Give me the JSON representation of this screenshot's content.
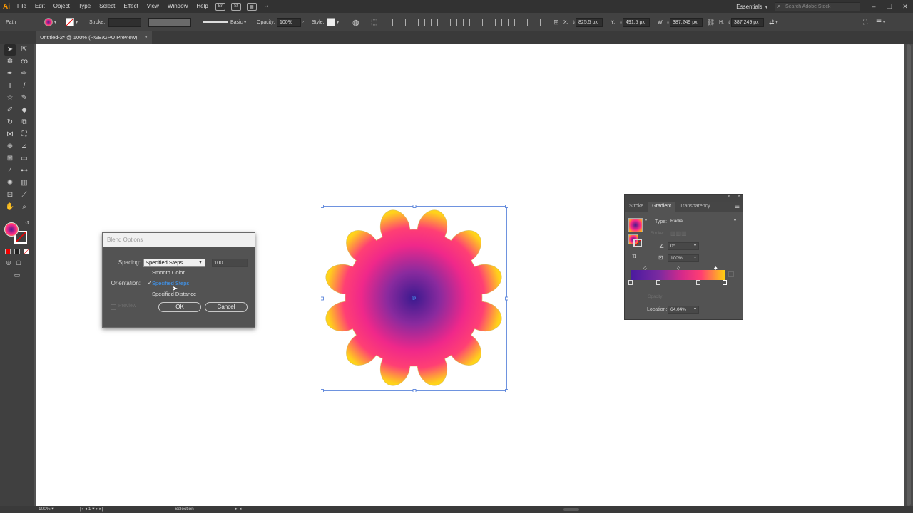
{
  "app": {
    "logo": "Ai"
  },
  "menu": [
    "File",
    "Edit",
    "Object",
    "Type",
    "Select",
    "Effect",
    "View",
    "Window",
    "Help"
  ],
  "menu_icons": [
    "Br",
    "St"
  ],
  "workspace": {
    "label": "Essentials"
  },
  "stock_search": {
    "placeholder": "Search Adobe Stock"
  },
  "control_bar": {
    "selection_type": "Path",
    "stroke_label": "Stroke:",
    "stroke_style": "Basic",
    "opacity_label": "Opacity:",
    "opacity_value": "100%",
    "style_label": "Style:",
    "x_label": "X:",
    "x_value": "825.5 px",
    "y_label": "Y:",
    "y_value": "491.5 px",
    "w_label": "W:",
    "w_value": "387.249 px",
    "h_label": "H:",
    "h_value": "387.249 px"
  },
  "document_tab": {
    "title": "Untitled-2* @ 100% (RGB/GPU Preview)",
    "close": "×"
  },
  "status_bar": {
    "zoom": "100%",
    "artboard": "1",
    "tool": "Selection"
  },
  "blend_dialog": {
    "title": "Blend Options",
    "spacing_label": "Spacing:",
    "spacing_value": "Specified Steps",
    "steps_value": "100",
    "orientation_label": "Orientation:",
    "options": [
      "Smooth Color",
      "Specified Steps",
      "Specified Distance"
    ],
    "selected_option": "Specified Steps",
    "preview_label": "Preview",
    "ok_label": "OK",
    "cancel_label": "Cancel"
  },
  "gradient_panel": {
    "tabs": [
      "Stroke",
      "Gradient",
      "Transparency"
    ],
    "active_tab": "Gradient",
    "type_label": "Type:",
    "type_value": "Radial",
    "stroke_label": "Stroke:",
    "angle_value": "0°",
    "aspect_value": "100%",
    "opacity_label": "Opacity:",
    "location_label": "Location:",
    "location_value": "64.04%"
  },
  "colors": {
    "gradient_center": "#4a1a8c",
    "gradient_mid": "#ff2a8a",
    "gradient_edge": "#ffd200",
    "selection_blue": "#3d6fd6",
    "active_option": "#3d9cff"
  },
  "icons": [
    "selection-tool-icon",
    "direct-selection-icon",
    "pen-icon",
    "type-icon",
    "hand-icon",
    "zoom-icon",
    "search-icon",
    "checkmark-icon",
    "cursor-icon"
  ]
}
